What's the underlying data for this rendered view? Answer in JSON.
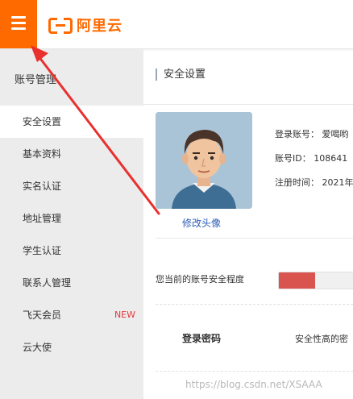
{
  "header": {
    "logo_text": "阿里云",
    "brand_color": "#ff6a00",
    "menu_icon": "hamburger-icon"
  },
  "sidebar": {
    "title": "账号管理",
    "items": [
      {
        "label": "安全设置",
        "active": true
      },
      {
        "label": "基本资料"
      },
      {
        "label": "实名认证"
      },
      {
        "label": "地址管理"
      },
      {
        "label": "学生认证"
      },
      {
        "label": "联系人管理"
      },
      {
        "label": "飞天会员",
        "badge": "NEW"
      },
      {
        "label": "云大使"
      }
    ]
  },
  "main": {
    "section_title": "安全设置",
    "change_avatar_label": "修改头像",
    "account_info": {
      "login_account": "登录账号： 爱喝哟",
      "account_id": "账号ID： 108641",
      "register_time": "注册时间： 2021年"
    },
    "security_level_label": "您当前的账号安全程度",
    "security_level_percent": 45,
    "password_label": "登录密码",
    "password_desc": "安全性高的密"
  },
  "watermark": "https://blog.csdn.net/XSAAA",
  "colors": {
    "annotation_arrow": "#e8312f",
    "security_bar_fill": "#d9534f",
    "link": "#2b5cb8"
  }
}
